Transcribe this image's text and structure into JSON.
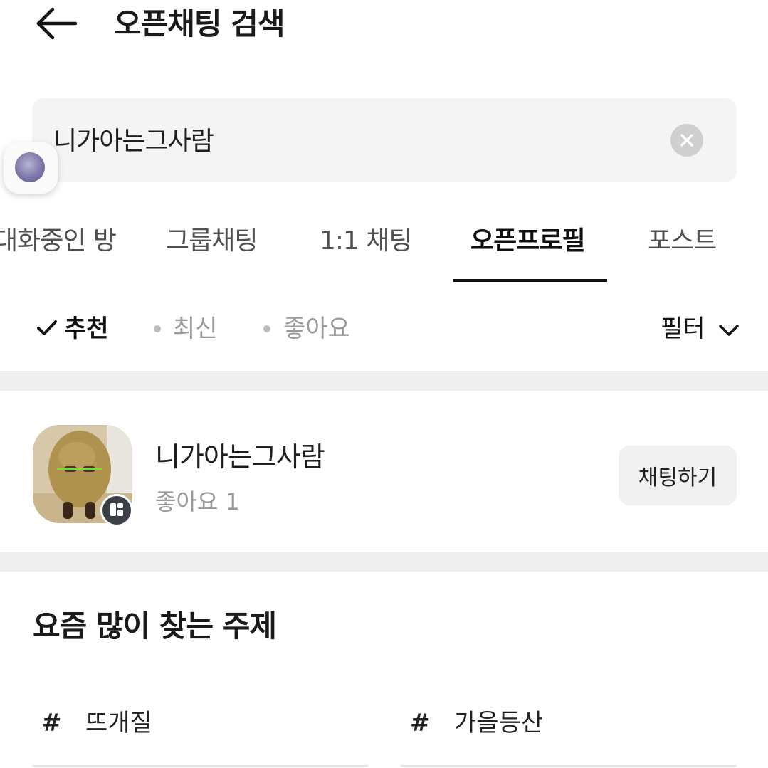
{
  "header": {
    "title": "오픈채팅 검색"
  },
  "search": {
    "query": "니가아는그사람"
  },
  "tabs": [
    {
      "label": "대화중인 방"
    },
    {
      "label": "그룹채팅"
    },
    {
      "label": "1:1 채팅"
    },
    {
      "label": "오픈프로필"
    },
    {
      "label": "포스트"
    }
  ],
  "sort": {
    "options": [
      {
        "label": "추천"
      },
      {
        "label": "최신"
      },
      {
        "label": "좋아요"
      }
    ],
    "selected": "추천",
    "filter_label": "필터"
  },
  "result": {
    "name": "니가아는그사람",
    "likes": "좋아요 1",
    "chat_button": "채팅하기"
  },
  "popular": {
    "title": "요즘 많이 찾는 주제",
    "hash": "#",
    "topics": [
      {
        "label": "뜨개질"
      },
      {
        "label": "가을등산"
      }
    ]
  },
  "icons": {
    "back": "arrow-left-icon",
    "clear": "clear-icon",
    "check": "check-icon",
    "chevron": "chevron-down-icon",
    "badge": "open-profile-icon"
  },
  "colors": {
    "text": "#1a1a1a",
    "muted": "#9a9a9a",
    "surface": "#f4f4f4",
    "divider": "#efefef"
  }
}
